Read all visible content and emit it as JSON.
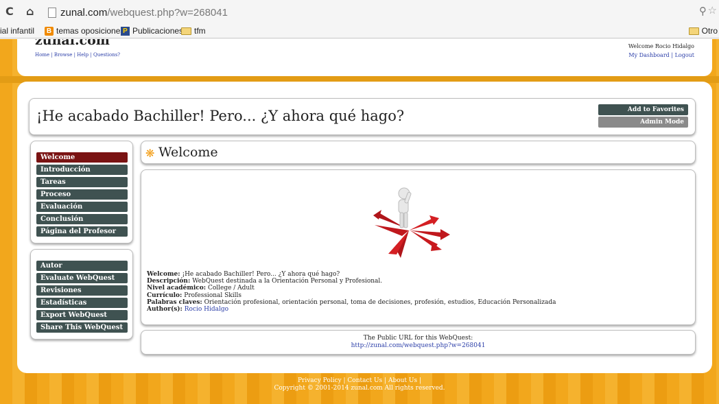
{
  "browser": {
    "url_host": "zunal.com",
    "url_path": "/webquest.php?w=268041",
    "bookmarks": [
      {
        "label": "ial infantil",
        "icon": "none"
      },
      {
        "label": "temas oposiciones",
        "icon": "orange-b-icon"
      },
      {
        "label": "Publicaciones",
        "icon": "p-icon"
      },
      {
        "label": "tfm",
        "icon": "folder-icon"
      }
    ],
    "other_bookmarks": "Otro"
  },
  "header": {
    "logo": "zunal.com",
    "links": [
      "Home",
      "Browse",
      "Help",
      "Questions?"
    ],
    "welcome_user": "Welcome Rocio Hidalgo",
    "user_links": [
      "My Dashboard",
      "Logout"
    ]
  },
  "title": {
    "text": "¡He acabado Bachiller! Pero... ¿Y ahora qué hago?",
    "add_favorites": "Add to Favorites",
    "admin_mode": "Admin Mode"
  },
  "sidebar": {
    "sections": [
      "Welcome",
      "Introducción",
      "Tareas",
      "Proceso",
      "Evaluación",
      "Conclusión",
      "Página del Profesor"
    ],
    "tools": [
      "Autor",
      "Evaluate WebQuest",
      "Revisiones",
      "Estadísticas",
      "Export WebQuest",
      "Share This WebQuest"
    ]
  },
  "main": {
    "heading": "Welcome",
    "welcome_label": "Welcome:",
    "welcome_value": "¡He acabado Bachiller! Pero... ¿Y ahora qué hago?",
    "desc_label": "Descripción:",
    "desc_value": "WebQuest destinada a la Orientación Personal y Profesional.",
    "level_label": "Nivel académico:",
    "level_value": "College / Adult",
    "curr_label": "Currículo:",
    "curr_value": "Professional Skills",
    "keywords_label": "Palabras claves:",
    "keywords_value": "Orientación profesional, orientación personal, toma de decisiones, profesión, estudios, Educación Personalizada",
    "author_label": "Author(s):",
    "author_value": "Rocio Hidalgo"
  },
  "public_url": {
    "label": "The Public URL for this WebQuest:",
    "url": "http://zunal.com/webquest.php?w=268041"
  },
  "footer": {
    "links": "Privacy Policy | Contact Us | About Us |",
    "copyright": "Copyright © 2001-2014 zunal.com All rights reserved."
  },
  "colors": {
    "accent_orange": "#f2a71c",
    "button_dark": "#3f5251",
    "button_active": "#7a1313",
    "link": "#2b3ea8"
  }
}
